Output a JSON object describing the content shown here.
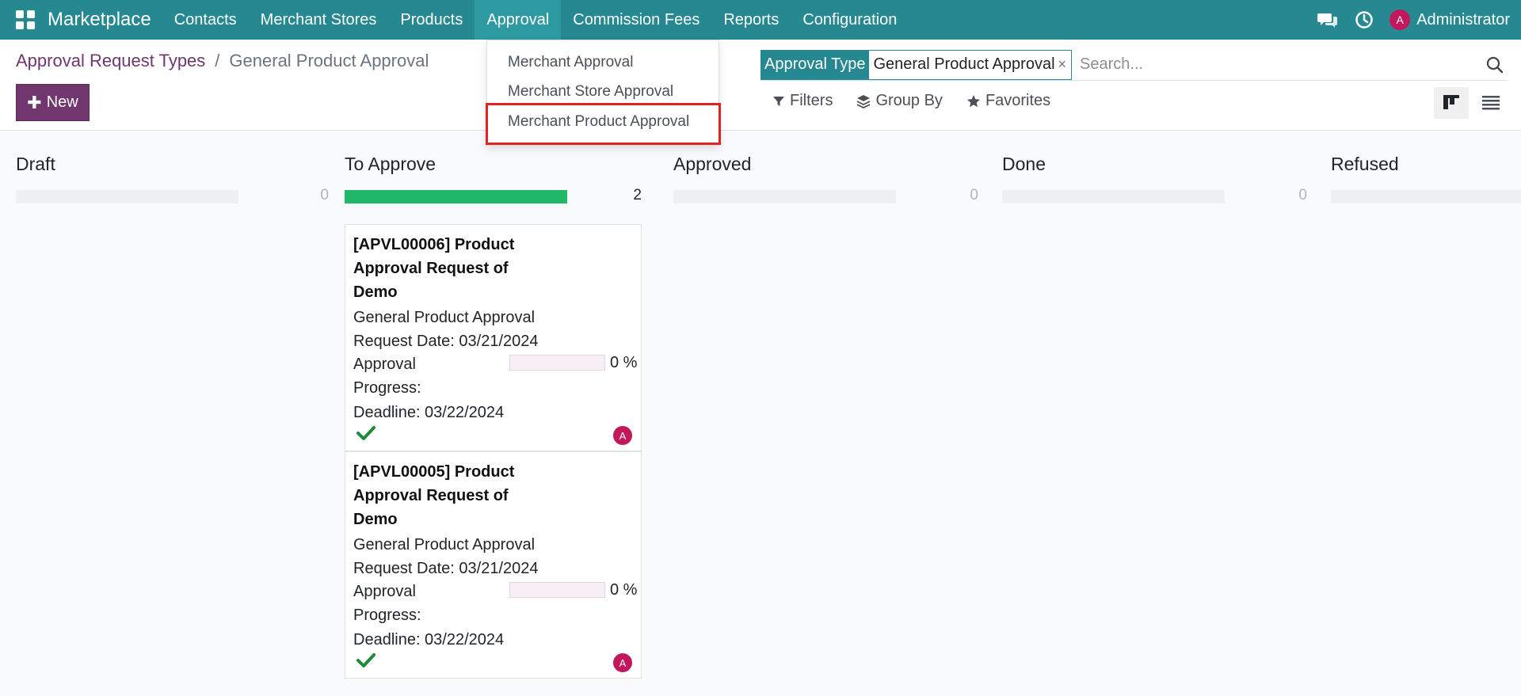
{
  "navbar": {
    "brand": "Marketplace",
    "menu": [
      {
        "label": "Contacts"
      },
      {
        "label": "Merchant Stores"
      },
      {
        "label": "Products"
      },
      {
        "label": "Approval"
      },
      {
        "label": "Commission Fees"
      },
      {
        "label": "Reports"
      },
      {
        "label": "Configuration"
      }
    ],
    "user_initial": "A",
    "user_name": "Administrator",
    "icons": [
      "apps-icon",
      "chat-icon",
      "clock-icon"
    ]
  },
  "breadcrumb": {
    "parent": "Approval Request Types",
    "separator": "/",
    "current": "General Product Approval"
  },
  "toolbar": {
    "new_label": "New"
  },
  "search": {
    "facet_label": "Approval Type",
    "facet_value": "General Product Approval",
    "facet_close": "×",
    "placeholder": "Search...",
    "filters_label": "Filters",
    "groupby_label": "Group By",
    "favorites_label": "Favorites"
  },
  "approval_dropdown": {
    "items": [
      "Merchant Approval",
      "Merchant Store Approval",
      "Merchant Product Approval"
    ],
    "highlighted_index": 2
  },
  "kanban": {
    "columns": [
      {
        "title": "Draft",
        "count": "0",
        "progress": 0
      },
      {
        "title": "To Approve",
        "count": "2",
        "progress": 1
      },
      {
        "title": "Approved",
        "count": "0",
        "progress": 0
      },
      {
        "title": "Done",
        "count": "0",
        "progress": 0
      },
      {
        "title": "Refused",
        "count": "",
        "progress": 0
      }
    ],
    "cards": [
      {
        "title": "[APVL00006] Product Approval Request of Demo",
        "type": "General Product Approval",
        "request_date": "Request Date: 03/21/2024",
        "progress_label": "Approval Progress:",
        "progress_value": 0,
        "progress_text": "0 %",
        "deadline": "Deadline: 03/22/2024",
        "assignee_initial": "A"
      },
      {
        "title": "[APVL00005] Product Approval Request of Demo",
        "type": "General Product Approval",
        "request_date": "Request Date: 03/21/2024",
        "progress_label": "Approval Progress:",
        "progress_value": 0,
        "progress_text": "0 %",
        "deadline": "Deadline: 03/22/2024",
        "assignee_initial": "A"
      }
    ]
  },
  "colors": {
    "navbar": "#268890",
    "primary": "#71366e",
    "progress": "#21b86a",
    "avatar": "#c2185b",
    "highlight": "#e02424"
  }
}
